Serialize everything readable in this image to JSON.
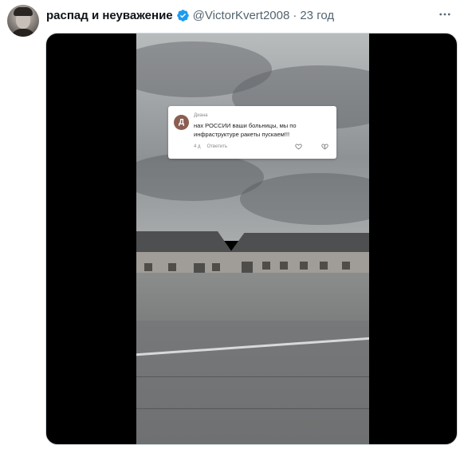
{
  "tweet": {
    "display_name": "распад и неуважение",
    "handle": "@VictorKvert2008",
    "separator": "·",
    "time": "23 год",
    "avatar_icon": "user-avatar-photo",
    "verified_icon": "verified-badge-icon",
    "more_icon": "more-options-icon"
  },
  "comment": {
    "avatar_letter": "Д",
    "author": "Диана",
    "text": "нах РОССИИ ваши больницы, мы по инфраструктуре ракеты пускаем!!!",
    "age": "4 д",
    "reply_label": "Ответить",
    "like_icon": "heart-icon",
    "dislike_icon": "broken-heart-icon"
  },
  "colors": {
    "name": "#0f1419",
    "secondary": "#536471",
    "verified": "#1d9bf0",
    "media_background": "#000000",
    "comment_avatar": "#8b5e52"
  }
}
